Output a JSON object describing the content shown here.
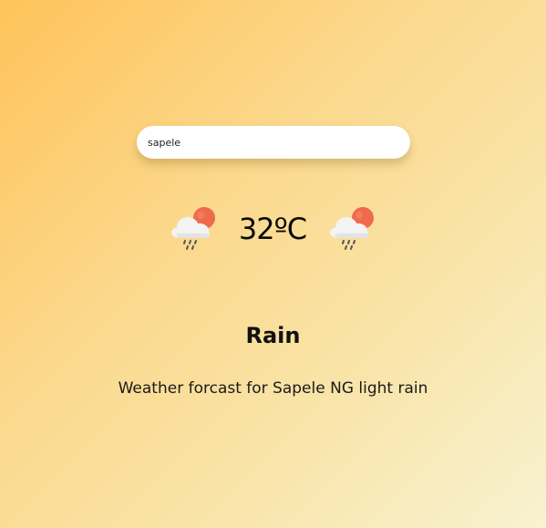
{
  "search": {
    "value": "sapele",
    "placeholder": ""
  },
  "weather": {
    "temperature": "32ºC",
    "condition": "Rain",
    "description": "Weather forcast for Sapele NG light rain",
    "icon": "rain-cloud-sun-icon"
  },
  "colors": {
    "background_start": "#ffc35a",
    "background_end": "#f8f2d0",
    "sun": "#f0674a",
    "cloud": "#f2f2f2",
    "rain": "#555555"
  }
}
